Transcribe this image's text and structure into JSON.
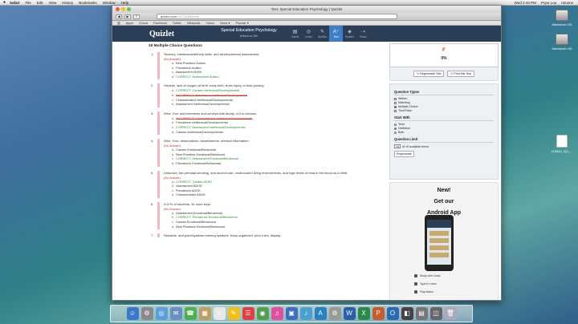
{
  "menubar": {
    "apple": "",
    "items": [
      "Safari",
      "File",
      "Edit",
      "View",
      "History",
      "Bookmarks",
      "Window",
      "Help"
    ],
    "right": [
      "Wed 2:43 PM",
      "Pryor Lou",
      "mmons"
    ]
  },
  "desktop": {
    "icons": [
      {
        "label": "Macintosh HD"
      },
      {
        "label": "Macintosh HD"
      },
      {
        "label": "110842_2(0_..."
      }
    ]
  },
  "window": {
    "title": "Test: Special Education Psychology | Quizlet",
    "url": "quizlet.com",
    "url_rest": "/24776869/test/",
    "bookmarks": [
      "Apple",
      "iCloud",
      "Facebook",
      "Twitter",
      "Wikipedia",
      "Yahoo",
      "News ▾",
      "Popular ▾"
    ]
  },
  "quizlet": {
    "logo": "Quizlet",
    "set_title": "Special Education Psychology",
    "back_link": "◂ Back to Set",
    "modes": [
      {
        "icon": "▤",
        "label": "Cards"
      },
      {
        "icon": "◎",
        "label": "Learn"
      },
      {
        "icon": "✎",
        "label": "Speller"
      },
      {
        "icon": "A⁺",
        "label": "Test"
      },
      {
        "icon": "◈",
        "label": "Scatter"
      },
      {
        "icon": "⇢",
        "label": "Race"
      }
    ]
  },
  "test": {
    "heading": "19 Multiple Choice Questions",
    "questions": [
      {
        "num": "1.",
        "text": "Sensory, intellectual/art/help skills, and developmental assessment.",
        "no_answer": "(No Answer)",
        "options": [
          {
            "letter": "a.",
            "text": "Best Practices Autism",
            "state": "normal"
          },
          {
            "letter": "b.",
            "text": "Prevalence Autism",
            "state": "normal"
          },
          {
            "letter": "c.",
            "text": "Assessment ADHD",
            "state": "normal"
          },
          {
            "letter": "d.",
            "text": "CORRECT: Assessment Autism",
            "state": "ok"
          }
        ]
      },
      {
        "num": "2.",
        "text": "Genetic, lack of oxygen at birth, early birth, brain injury, or lead poising.",
        "no_answer": "",
        "options": [
          {
            "letter": "a.",
            "text": "CORRECT: Causes Intellectual/Developmental",
            "state": "ok"
          },
          {
            "letter": "b.",
            "text": "INCORRECT: Prevalence Intellectual/Developmental",
            "state": "bad"
          },
          {
            "letter": "c.",
            "text": "Characteristics Intellectual/Developmental",
            "state": "normal"
          },
          {
            "letter": "d.",
            "text": "Assessment Intellectual/Developmental",
            "state": "normal"
          }
        ]
      },
      {
        "num": "3.",
        "text": "Who: Your and interviews and surveys with family, or it is obvious.",
        "no_answer": "",
        "options": [
          {
            "letter": "a.",
            "text": "INCORRECT: Characteristics Intellectual/Developmental",
            "state": "bad"
          },
          {
            "letter": "b.",
            "text": "Prevalence Intellectual/Developmental",
            "state": "normal"
          },
          {
            "letter": "c.",
            "text": "CORRECT: Assessment Intellectual/Developmental",
            "state": "ok"
          },
          {
            "letter": "d.",
            "text": "Causes Intellectual/Developmental",
            "state": "normal"
          }
        ]
      },
      {
        "num": "4.",
        "text": "Who: Your, observations, assessments, medical information.",
        "no_answer": "(No Answer)",
        "options": [
          {
            "letter": "a.",
            "text": "Causes Emotional/Behavioral",
            "state": "normal"
          },
          {
            "letter": "b.",
            "text": "Best Practices Emotional/Behavioral",
            "state": "normal"
          },
          {
            "letter": "c.",
            "text": "CORRECT: Assessment Emotional/Behavioral",
            "state": "ok"
          },
          {
            "letter": "d.",
            "text": "Prevalence Emotional/Behavioral",
            "state": "normal"
          }
        ]
      },
      {
        "num": "5.",
        "text": "Unknown, but prenatal smoking, and alcohol use, unstructured living environments, and high levels of lead in the blood as a child.",
        "no_answer": "(No Answer)",
        "options": [
          {
            "letter": "a.",
            "text": "CORRECT: Causes ADHD",
            "state": "ok"
          },
          {
            "letter": "b.",
            "text": "Assessment ADHD",
            "state": "normal"
          },
          {
            "letter": "c.",
            "text": "Prevalence ADHD",
            "state": "normal"
          },
          {
            "letter": "d.",
            "text": "Characteristics ADHD",
            "state": "normal"
          }
        ]
      },
      {
        "num": "6.",
        "text": "0.67% of students. 3x more boys",
        "no_answer": "(No Answer)",
        "options": [
          {
            "letter": "a.",
            "text": "Assessment Emotional/Behavioral",
            "state": "normal"
          },
          {
            "letter": "b.",
            "text": "CORRECT: Prevalence Emotional/Behavioral",
            "state": "ok"
          },
          {
            "letter": "c.",
            "text": "Causes Emotional/Behavioral",
            "state": "normal"
          },
          {
            "letter": "d.",
            "text": "Best Practices Emotional/Behavioral",
            "state": "normal"
          }
        ]
      },
      {
        "num": "7.",
        "text": "Rewards, and point/systems earning systems. Keep organized, prior rules, display.",
        "no_answer": "",
        "options": []
      }
    ]
  },
  "sidebar": {
    "grade": "F",
    "percent": "0%",
    "regenerate": "↻ Regenerate Test",
    "print": "⎙ Print this Test",
    "question_types_title": "Question Types",
    "question_types": [
      {
        "label": "Written",
        "checked": false
      },
      {
        "label": "Matching",
        "checked": false
      },
      {
        "label": "Multiple Choice",
        "checked": true
      },
      {
        "label": "True/False",
        "checked": false
      }
    ],
    "start_with_title": "Start With",
    "start_with": [
      {
        "label": "Term",
        "checked": false
      },
      {
        "label": "Definition",
        "checked": true
      },
      {
        "label": "Both",
        "checked": false
      }
    ],
    "limit_title": "Question Limit",
    "limit_value": "19",
    "limit_suffix": "of 19 available terms",
    "regen_button": "Regenerate",
    "ad": {
      "line1": "New!",
      "line2": "Get our",
      "line3": "Android App",
      "features": [
        "Study with Cards",
        "Type to Learn",
        "Play Match"
      ]
    }
  },
  "dock": {
    "items": [
      {
        "icon": "☺",
        "color": "#3a78c9"
      },
      {
        "icon": "⚙",
        "color": "#8a8a8a"
      },
      {
        "icon": "◎",
        "color": "#5aa0e0"
      },
      {
        "icon": "✉",
        "color": "#6b8fc2"
      },
      {
        "icon": "☎",
        "color": "#4caf50"
      },
      {
        "icon": "▦",
        "color": "#c0a060"
      },
      {
        "icon": "5",
        "color": "#e8e8e8"
      },
      {
        "icon": "✎",
        "color": "#f0c020"
      },
      {
        "icon": "☰",
        "color": "#e04040"
      },
      {
        "icon": "◉",
        "color": "#50a050"
      },
      {
        "icon": "♫",
        "color": "#e050a0"
      },
      {
        "icon": "▣",
        "color": "#3a6ec0"
      },
      {
        "icon": "♪",
        "color": "#4aa0d0"
      },
      {
        "icon": "A",
        "color": "#2a80c0"
      },
      {
        "icon": "⚙",
        "color": "#9a9a9a"
      },
      {
        "icon": "W",
        "color": "#2b5fa8"
      },
      {
        "icon": "X",
        "color": "#2a8a4a"
      },
      {
        "icon": "P",
        "color": "#c85a30"
      },
      {
        "icon": "O",
        "color": "#2a6ab0"
      },
      {
        "icon": "◧",
        "color": "#444"
      },
      {
        "icon": "▤",
        "color": "#777"
      },
      {
        "icon": "◫",
        "color": "#666"
      },
      {
        "icon": "🗑",
        "color": "#aab"
      }
    ]
  }
}
